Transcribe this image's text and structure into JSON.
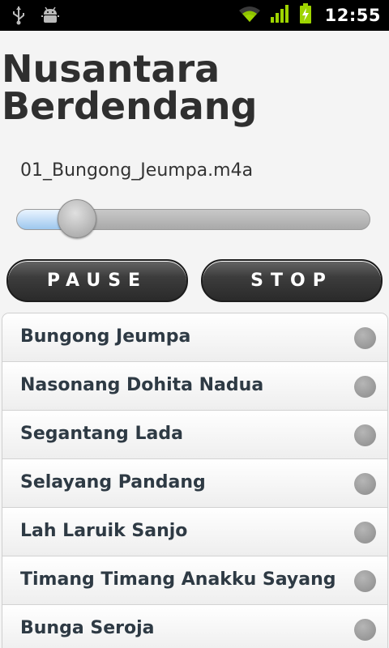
{
  "status_bar": {
    "time": "12:55",
    "icons": [
      "usb-icon",
      "android-debug-icon",
      "wifi-icon",
      "signal-icon",
      "battery-charging-icon"
    ]
  },
  "app": {
    "title": "Nusantara Berdendang",
    "current_file": "01_Bungong_Jeumpa.m4a"
  },
  "player": {
    "progress": 0.17,
    "pause_label": "PAUSE",
    "stop_label": "STOP"
  },
  "songs": [
    {
      "title": "Bungong Jeumpa"
    },
    {
      "title": "Nasonang Dohita Nadua"
    },
    {
      "title": "Segantang Lada"
    },
    {
      "title": "Selayang Pandang"
    },
    {
      "title": "Lah Laruik Sanjo"
    },
    {
      "title": "Timang Timang Anakku Sayang"
    },
    {
      "title": "Bunga Seroja"
    }
  ],
  "colors": {
    "status_bar": "#000000",
    "title_text": "#2f2f2f",
    "list_text": "#2e3a44",
    "seek_fill": "#9dc7ee",
    "battery": "#9ed400"
  }
}
